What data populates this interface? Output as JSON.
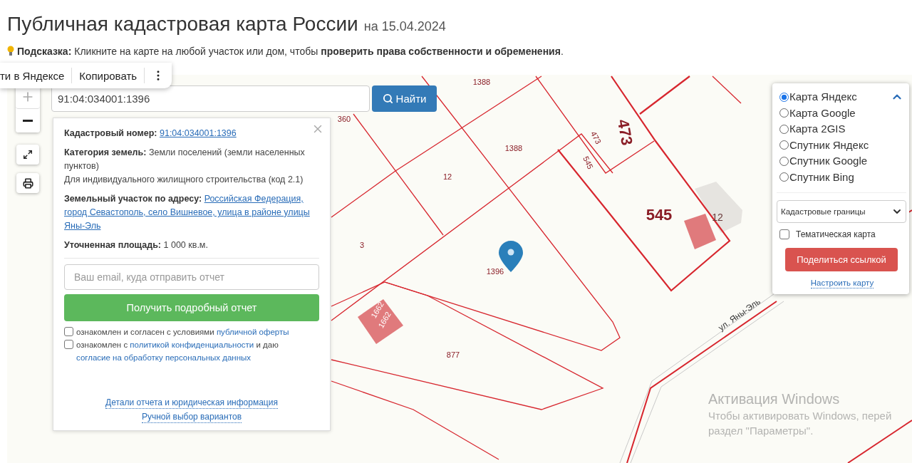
{
  "header": {
    "title": "Публичная кадастровая карта России",
    "date": "на 15.04.2024"
  },
  "hint": {
    "label": "Подсказка:",
    "text": "Кликните на карте на любой участок или дом, чтобы **проверить права собственности и обременения**."
  },
  "context_menu": {
    "items": [
      "ти в Яндексе",
      "Копировать"
    ]
  },
  "search": {
    "value": "91:04:034001:1396",
    "button": "Найти"
  },
  "info_panel": {
    "fields": [
      {
        "label": "Кадастровый номер:",
        "value": "91:04:034001:1396",
        "kind": "link"
      },
      {
        "label": "Категория земель:",
        "value": "Земли поселений (земли населенных пунктов)",
        "note": "Для индивидуального жилищного строительства (код 2.1)",
        "kind": "text"
      },
      {
        "label": "Земельный участок по адресу:",
        "value": "Российская Федерация, город Севастополь, село Вишневое, улица в районе улицы Яны-Эль",
        "kind": "link"
      },
      {
        "label": "Уточненная площадь:",
        "value": "1 000 кв.м.",
        "kind": "text"
      }
    ],
    "email_placeholder": "Ваш email, куда отправить отчет",
    "submit_button": "Получить подробный отчет",
    "consents": [
      {
        "checked": false,
        "parts": [
          {
            "kind": "text",
            "text": "ознакомлен и согласен с условиями "
          },
          {
            "kind": "link",
            "text": "публичной оферты"
          }
        ]
      },
      {
        "checked": false,
        "parts": [
          {
            "kind": "text",
            "text": "ознакомлен с "
          },
          {
            "kind": "link",
            "text": "политикой конфиденциальности"
          },
          {
            "kind": "text",
            "text": " и даю "
          },
          {
            "kind": "link",
            "text": "согласие на обработку персональных данных"
          }
        ]
      }
    ],
    "footer_links": [
      "Детали отчета и юридическая информация",
      "Ручной выбор вариантов"
    ]
  },
  "layers_panel": {
    "expanded": true,
    "base_maps": [
      {
        "label": "Карта Яндекс",
        "selected": true
      },
      {
        "label": "Карта Google",
        "selected": false
      },
      {
        "label": "Карта 2GIS",
        "selected": false
      },
      {
        "label": "Спутник Яндекс",
        "selected": false
      },
      {
        "label": "Спутник Google",
        "selected": false
      },
      {
        "label": "Спутник Bing",
        "selected": false
      }
    ],
    "overlay_select": "Кадастровые границы",
    "thematic": {
      "label": "Тематическая карта",
      "checked": false
    },
    "share_button": "Поделиться ссылкой",
    "settings_link": "Настроить карту"
  },
  "map_labels": [
    {
      "text": "1388",
      "kind": "parcel"
    },
    {
      "text": "360",
      "kind": "parcel"
    },
    {
      "text": "1388",
      "kind": "parcel"
    },
    {
      "text": "12",
      "kind": "parcel"
    },
    {
      "text": "473",
      "kind": "parcel"
    },
    {
      "text": "473",
      "kind": "parcel"
    },
    {
      "text": "545",
      "kind": "parcel"
    },
    {
      "text": "545",
      "kind": "parcel"
    },
    {
      "text": "12",
      "kind": "building"
    },
    {
      "text": "3",
      "kind": "parcel"
    },
    {
      "text": "1396",
      "kind": "parcel"
    },
    {
      "text": "1662",
      "kind": "building"
    },
    {
      "text": "1662",
      "kind": "building"
    },
    {
      "text": "877",
      "kind": "parcel"
    },
    {
      "text": "ул. Яны-Эль",
      "kind": "street"
    }
  ],
  "windows_activation": {
    "title": "Активация Windows",
    "lines": [
      "Чтобы активировать Windows, перей",
      "раздел \"Параметры\"."
    ]
  }
}
